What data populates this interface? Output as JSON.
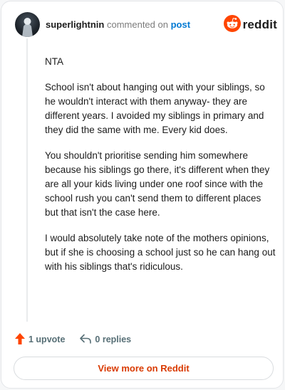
{
  "header": {
    "username": "superlightnin",
    "action_text": "commented on",
    "post_link": "post",
    "brand": "reddit"
  },
  "comment": {
    "paragraphs": [
      "NTA",
      "School isn't about hanging out with your siblings, so he wouldn't interact with them anyway- they are different years. I avoided my siblings in primary and they did the same with me. Every kid does.",
      "You shouldn't prioritise sending him somewhere because his siblings go there, it's different when they are all your kids living under one roof since with the school rush you can't send them to different places but that isn't the case here.",
      "I would absolutely take note of the mothers opinions, but if she is choosing a school just so he can hang out with his siblings that's ridiculous."
    ]
  },
  "actions": {
    "upvote_label": "1 upvote",
    "replies_label": "0 replies"
  },
  "footer": {
    "view_more_label": "View more on Reddit"
  },
  "colors": {
    "brand_orange": "#ff4500",
    "link_blue": "#0079d3",
    "cta_text": "#d93a00"
  },
  "icons": [
    "avatar",
    "reddit-logo-icon",
    "upvote-arrow-icon",
    "reply-arrow-icon"
  ]
}
